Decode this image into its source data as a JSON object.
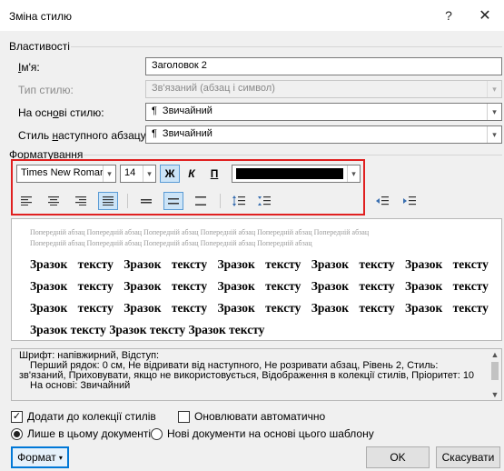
{
  "window": {
    "title": "Зміна стилю",
    "help": "?",
    "close": "✕"
  },
  "properties": {
    "group": "Властивості",
    "name_label": "Ім'я:",
    "name_value": "Заголовок 2",
    "type_label": "Тип стилю:",
    "type_value": "Зв'язаний (абзац і символ)",
    "based_label": "На основі стилю:",
    "based_value": "Звичайний",
    "next_label": "Стиль наступного абзацу:",
    "next_value": "Звичайний",
    "para_mark": "¶"
  },
  "formatting": {
    "group": "Форматування",
    "font": "Times New Roman",
    "size": "14",
    "bold": "Ж",
    "italic": "К",
    "underline": "П",
    "font_color": "#000000"
  },
  "preview": {
    "prev_line1": "Попередній абзац Попередній абзац Попередній абзац Попередній абзац Попередній абзац Попередній абзац",
    "prev_line2": "Попередній абзац Попередній абзац Попередній абзац Попередній абзац Попередній абзац",
    "sample_word": "Зразок",
    "sample_word2": "тексту",
    "last_line": "Зразок тексту Зразок тексту Зразок тексту"
  },
  "description": {
    "line1": "Шрифт: напівжирний, Відступ:",
    "line2": "Перший рядок:  0 см, Не відривати від наступного, Не розривати абзац, Рівень 2, Стиль:",
    "line3": "зв'язаний, Приховувати, якщо не використовується, Відображення в колекції стилів, Пріоритет: 10",
    "line4": "На основі: Звичайний"
  },
  "options": {
    "add_to_gallery": "Додати до колекції стилів",
    "auto_update": "Оновлювати автоматично",
    "only_this_doc": "Лише в цьому документі",
    "new_docs": "Нові документи на основі цього шаблону"
  },
  "buttons": {
    "format": "Формат",
    "ok": "OK",
    "cancel": "Скасувати"
  }
}
